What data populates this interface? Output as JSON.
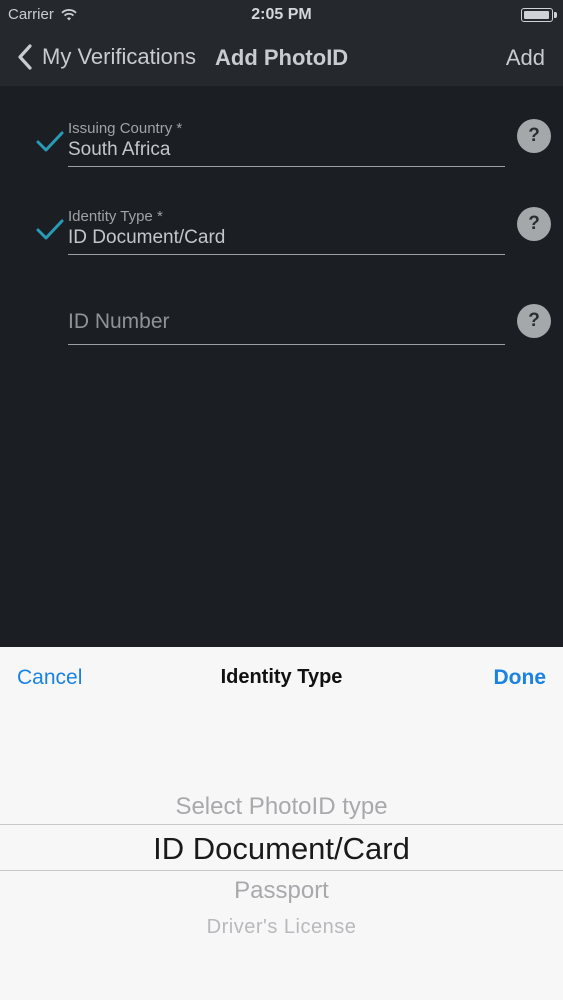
{
  "status_bar": {
    "carrier": "Carrier",
    "time": "2:05 PM",
    "battery_level": 1.0
  },
  "nav": {
    "back_label": "My Verifications",
    "title": "Add PhotoID",
    "action_label": "Add"
  },
  "form": {
    "issuing_country": {
      "label": "Issuing Country *",
      "value": "South Africa",
      "valid": true
    },
    "identity_type": {
      "label": "Identity Type *",
      "value": "ID Document/Card",
      "valid": true
    },
    "id_number": {
      "placeholder": "ID Number",
      "value": ""
    },
    "help_glyph": "?"
  },
  "picker": {
    "cancel_label": "Cancel",
    "title": "Identity Type",
    "done_label": "Done",
    "options": [
      "Select PhotoID type",
      "ID Document/Card",
      "Passport",
      "Driver's License"
    ],
    "selected_index": 1
  },
  "colors": {
    "accent": "#1a82e2",
    "check": "#2a9ab8",
    "background": "#1b1f23"
  }
}
